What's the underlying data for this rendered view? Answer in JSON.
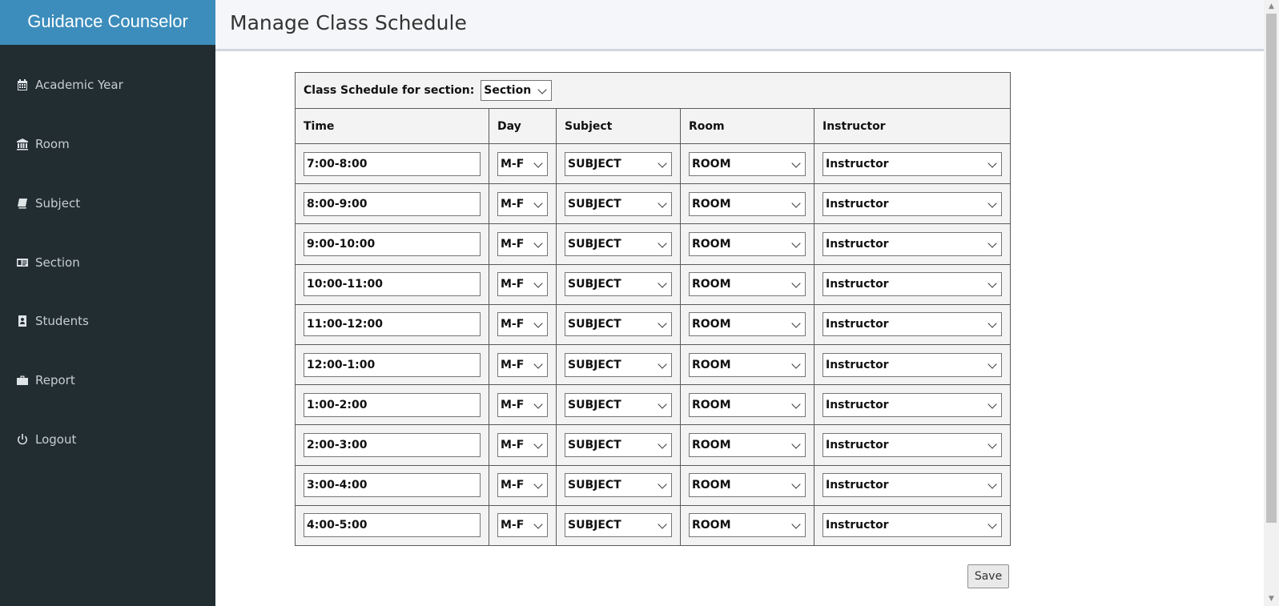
{
  "sidebar": {
    "brand": "Guidance Counselor",
    "items": [
      {
        "label": "Academic Year",
        "icon": "calendar-icon"
      },
      {
        "label": "Room",
        "icon": "bank-icon"
      },
      {
        "label": "Subject",
        "icon": "book-icon"
      },
      {
        "label": "Section",
        "icon": "id-card-icon"
      },
      {
        "label": "Students",
        "icon": "contact-book-icon"
      },
      {
        "label": "Report",
        "icon": "briefcase-icon"
      },
      {
        "label": "Logout",
        "icon": "power-icon"
      }
    ]
  },
  "header": {
    "title": "Manage Class Schedule"
  },
  "schedule": {
    "caption": "Class Schedule for section:",
    "section_value": "Section",
    "columns": [
      "Time",
      "Day",
      "Subject",
      "Room",
      "Instructor"
    ],
    "rows": [
      {
        "time": "7:00-8:00",
        "day": "M-F",
        "subject": "SUBJECT",
        "room": "ROOM",
        "instructor": "Instructor"
      },
      {
        "time": "8:00-9:00",
        "day": "M-F",
        "subject": "SUBJECT",
        "room": "ROOM",
        "instructor": "Instructor"
      },
      {
        "time": "9:00-10:00",
        "day": "M-F",
        "subject": "SUBJECT",
        "room": "ROOM",
        "instructor": "Instructor"
      },
      {
        "time": "10:00-11:00",
        "day": "M-F",
        "subject": "SUBJECT",
        "room": "ROOM",
        "instructor": "Instructor"
      },
      {
        "time": "11:00-12:00",
        "day": "M-F",
        "subject": "SUBJECT",
        "room": "ROOM",
        "instructor": "Instructor"
      },
      {
        "time": "12:00-1:00",
        "day": "M-F",
        "subject": "SUBJECT",
        "room": "ROOM",
        "instructor": "Instructor"
      },
      {
        "time": "1:00-2:00",
        "day": "M-F",
        "subject": "SUBJECT",
        "room": "ROOM",
        "instructor": "Instructor"
      },
      {
        "time": "2:00-3:00",
        "day": "M-F",
        "subject": "SUBJECT",
        "room": "ROOM",
        "instructor": "Instructor"
      },
      {
        "time": "3:00-4:00",
        "day": "M-F",
        "subject": "SUBJECT",
        "room": "ROOM",
        "instructor": "Instructor"
      },
      {
        "time": "4:00-5:00",
        "day": "M-F",
        "subject": "SUBJECT",
        "room": "ROOM",
        "instructor": "Instructor"
      }
    ],
    "save_label": "Save"
  },
  "colors": {
    "brand": "#3c8dbc",
    "sidebar_bg": "#222d32",
    "sidebar_text": "#c7ced2",
    "header_bg": "#f4f6f9",
    "table_bg": "#f3f3f3"
  }
}
